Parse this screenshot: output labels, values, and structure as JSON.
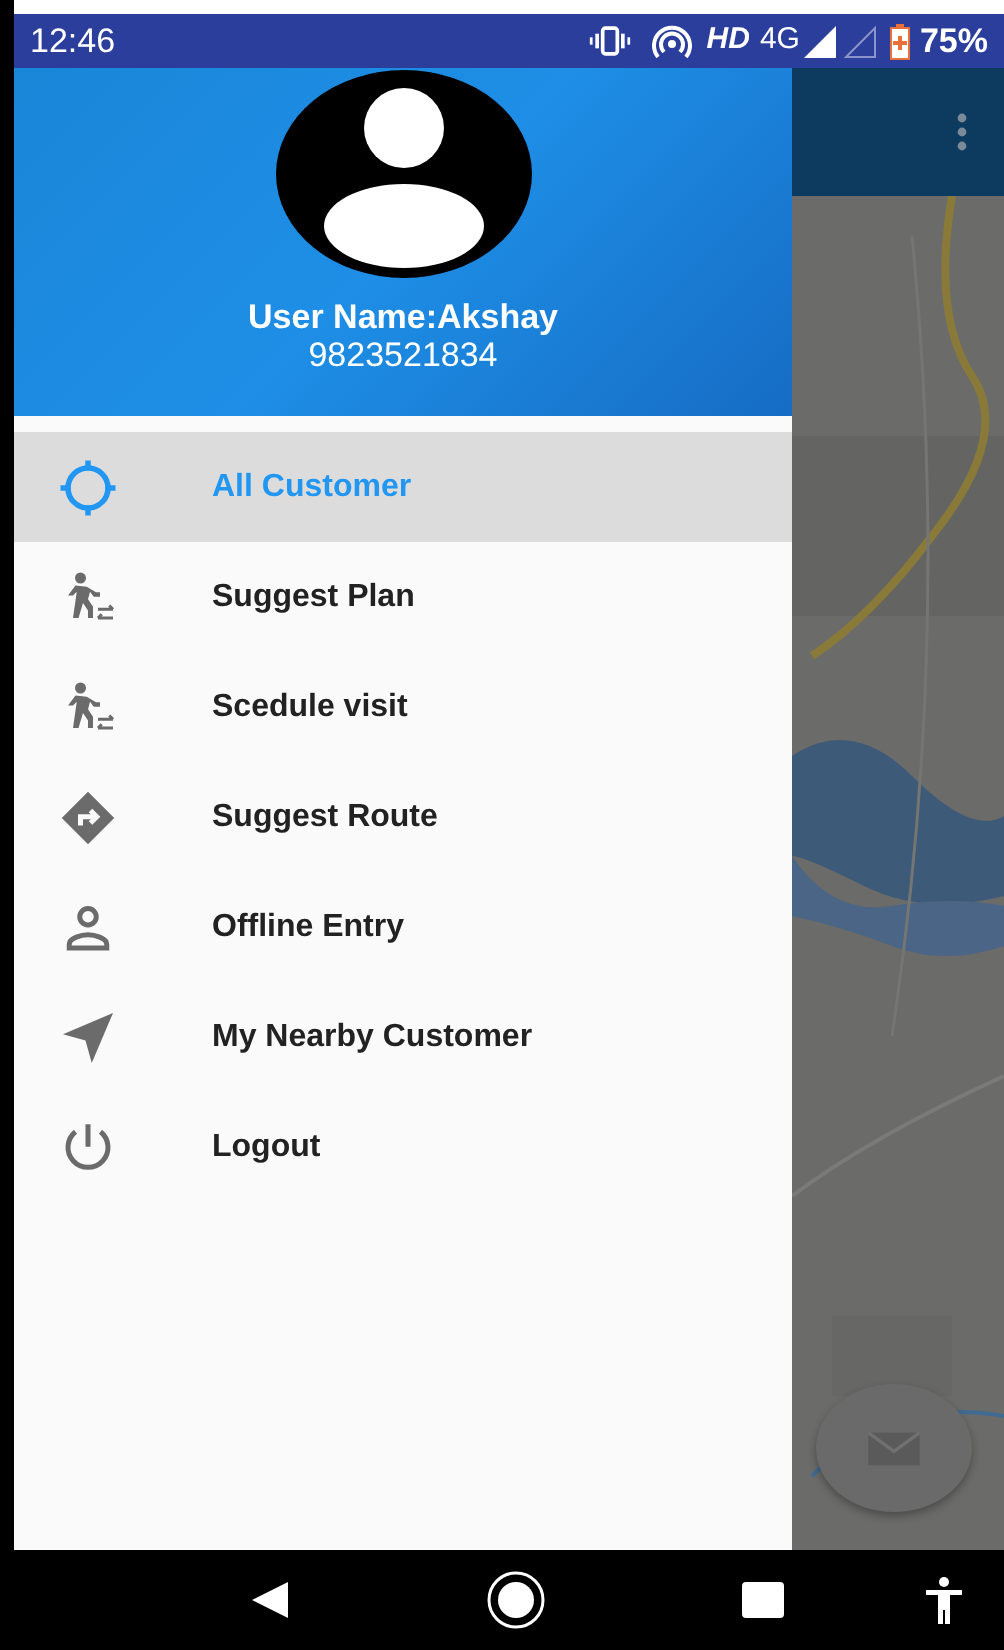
{
  "status_bar": {
    "time": "12:46",
    "hd": "HD",
    "network": "4G",
    "battery": "75%"
  },
  "drawer": {
    "user_name": "User Name:Akshay",
    "phone": "9823521834",
    "items": [
      {
        "label": "All Customer",
        "kind": "crosshair",
        "selected": true
      },
      {
        "label": "Suggest Plan",
        "kind": "walk",
        "selected": false
      },
      {
        "label": "Scedule visit",
        "kind": "walk",
        "selected": false
      },
      {
        "label": "Suggest Route",
        "kind": "route",
        "selected": false
      },
      {
        "label": "Offline Entry",
        "kind": "person",
        "selected": false
      },
      {
        "label": "My Nearby Customer",
        "kind": "navigate",
        "selected": false
      },
      {
        "label": "Logout",
        "kind": "power",
        "selected": false
      }
    ]
  }
}
